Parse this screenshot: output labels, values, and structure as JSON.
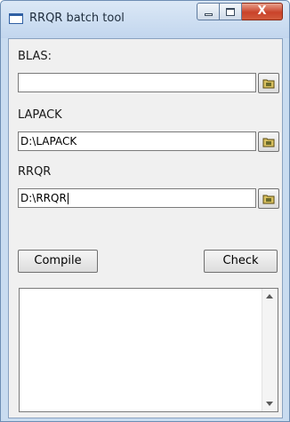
{
  "window": {
    "title": "RRQR batch tool",
    "close_glyph": "X"
  },
  "fields": [
    {
      "label": "BLAS:",
      "value": "",
      "browse_icon": "folder-icon"
    },
    {
      "label": "LAPACK",
      "value": "D:\\LAPACK",
      "browse_icon": "folder-icon"
    },
    {
      "label": "RRQR",
      "value": "D:\\RRQR",
      "browse_icon": "folder-icon"
    }
  ],
  "buttons": {
    "compile_label": "Compile",
    "check_label": "Check"
  },
  "output": {
    "text": ""
  },
  "colors": {
    "title_bar": "#c9dcf0",
    "close_button": "#c9432a",
    "client_bg": "#f0f0f0"
  }
}
